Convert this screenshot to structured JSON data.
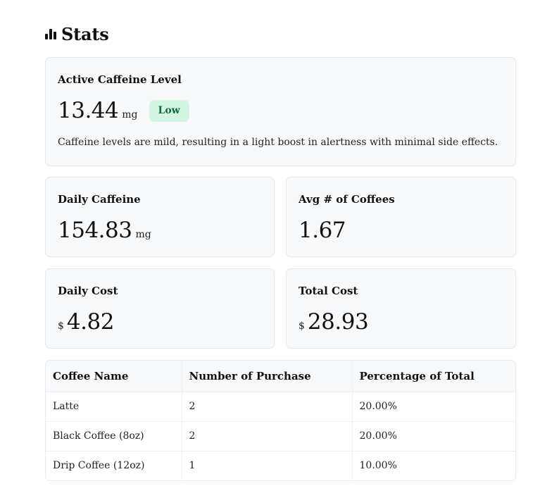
{
  "header": {
    "icon": "bar-chart-icon",
    "title": "Stats"
  },
  "active_caffeine": {
    "label": "Active Caffeine Level",
    "value": "13.44",
    "unit": "mg",
    "badge": "Low",
    "badge_color": "#d4f5e2",
    "badge_text_color": "#0f6b45",
    "description": "Caffeine levels are mild, resulting in a light boost in alertness with minimal side effects."
  },
  "daily_caffeine": {
    "label": "Daily Caffeine",
    "value": "154.83",
    "unit": "mg"
  },
  "avg_coffees": {
    "label": "Avg # of Coffees",
    "value": "1.67"
  },
  "daily_cost": {
    "label": "Daily Cost",
    "prefix": "$",
    "value": "4.82"
  },
  "total_cost": {
    "label": "Total Cost",
    "prefix": "$",
    "value": "28.93"
  },
  "table": {
    "columns": [
      "Coffee Name",
      "Number of Purchase",
      "Percentage of Total"
    ],
    "rows": [
      [
        "Latte",
        "2",
        "20.00%"
      ],
      [
        "Black Coffee (8oz)",
        "2",
        "20.00%"
      ],
      [
        "Drip Coffee (12oz)",
        "1",
        "10.00%"
      ]
    ]
  },
  "colors": {
    "card_background": "#f7f9fb",
    "card_border": "#e5e9ee"
  }
}
